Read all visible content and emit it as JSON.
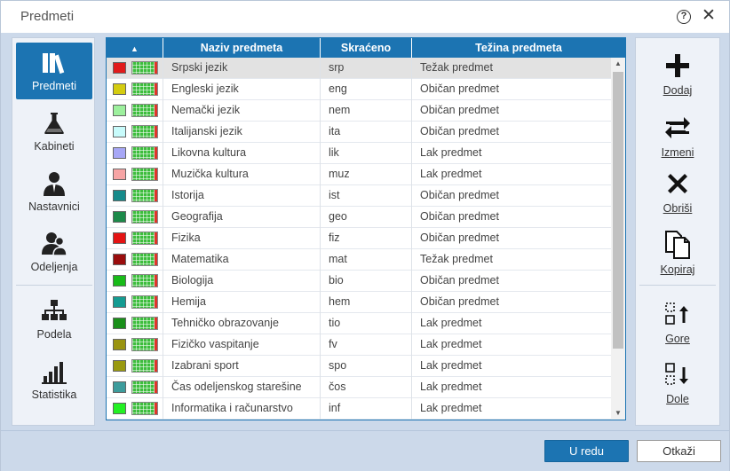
{
  "window": {
    "title": "Predmeti",
    "help_label": "?",
    "close_label": "✕"
  },
  "nav": {
    "items": [
      {
        "label": "Predmeti",
        "icon": "books-icon",
        "active": true
      },
      {
        "label": "Kabineti",
        "icon": "flask-icon",
        "active": false
      },
      {
        "label": "Nastavnici",
        "icon": "teacher-icon",
        "active": false
      },
      {
        "label": "Odeljenja",
        "icon": "group-icon",
        "active": false
      },
      {
        "label": "Podela",
        "icon": "org-chart-icon",
        "active": false
      },
      {
        "label": "Statistika",
        "icon": "bar-chart-icon",
        "active": false
      }
    ]
  },
  "table": {
    "sort_indicator": "▲",
    "columns": [
      "Naziv predmeta",
      "Skraćeno",
      "Težina predmeta"
    ],
    "rows": [
      {
        "color": "#e11b1b",
        "name": "Srpski jezik",
        "short": "srp",
        "weight": "Težak predmet",
        "selected": true
      },
      {
        "color": "#d4cc10",
        "name": "Engleski jezik",
        "short": "eng",
        "weight": "Običan predmet"
      },
      {
        "color": "#9df09d",
        "name": "Nemački jezik",
        "short": "nem",
        "weight": "Običan predmet"
      },
      {
        "color": "#c8fbfb",
        "name": "Italijanski jezik",
        "short": "ita",
        "weight": "Običan predmet"
      },
      {
        "color": "#a7a7f6",
        "name": "Likovna kultura",
        "short": "lik",
        "weight": "Lak predmet"
      },
      {
        "color": "#f7a5a5",
        "name": "Muzička kultura",
        "short": "muz",
        "weight": "Lak predmet"
      },
      {
        "color": "#168a8a",
        "name": "Istorija",
        "short": "ist",
        "weight": "Običan predmet"
      },
      {
        "color": "#1d8a4a",
        "name": "Geografija",
        "short": "geo",
        "weight": "Običan predmet"
      },
      {
        "color": "#e41414",
        "name": "Fizika",
        "short": "fiz",
        "weight": "Običan predmet"
      },
      {
        "color": "#9a0d0d",
        "name": "Matematika",
        "short": "mat",
        "weight": "Težak predmet"
      },
      {
        "color": "#19bb19",
        "name": "Biologija",
        "short": "bio",
        "weight": "Običan predmet"
      },
      {
        "color": "#159c92",
        "name": "Hemija",
        "short": "hem",
        "weight": "Običan predmet"
      },
      {
        "color": "#1a8f1a",
        "name": "Tehničko obrazovanje",
        "short": "tio",
        "weight": "Lak predmet"
      },
      {
        "color": "#9a9410",
        "name": "Fizičko vaspitanje",
        "short": "fv",
        "weight": "Lak predmet"
      },
      {
        "color": "#9a9a10",
        "name": "Izabrani sport",
        "short": "spo",
        "weight": "Lak predmet"
      },
      {
        "color": "#3d9c9c",
        "name": "Čas odeljenskog starešine",
        "short": "čos",
        "weight": "Lak predmet"
      },
      {
        "color": "#23f023",
        "name": "Informatika i računarstvo",
        "short": "inf",
        "weight": "Lak predmet"
      }
    ],
    "scroll_up": "▲",
    "scroll_down": "▼"
  },
  "actions": [
    {
      "label": "Dodaj",
      "icon": "plus-icon"
    },
    {
      "label": "Izmeni",
      "icon": "swap-arrows-icon"
    },
    {
      "label": "Obriši",
      "icon": "delete-x-icon"
    },
    {
      "label": "Kopiraj",
      "icon": "copy-icon"
    },
    {
      "label": "Gore",
      "icon": "move-up-icon"
    },
    {
      "label": "Dole",
      "icon": "move-down-icon"
    }
  ],
  "footer": {
    "ok_label": "U redu",
    "cancel_label": "Otkaži"
  },
  "colors": {
    "accent": "#1c74b2",
    "panel_bg": "#ccd9ea"
  }
}
